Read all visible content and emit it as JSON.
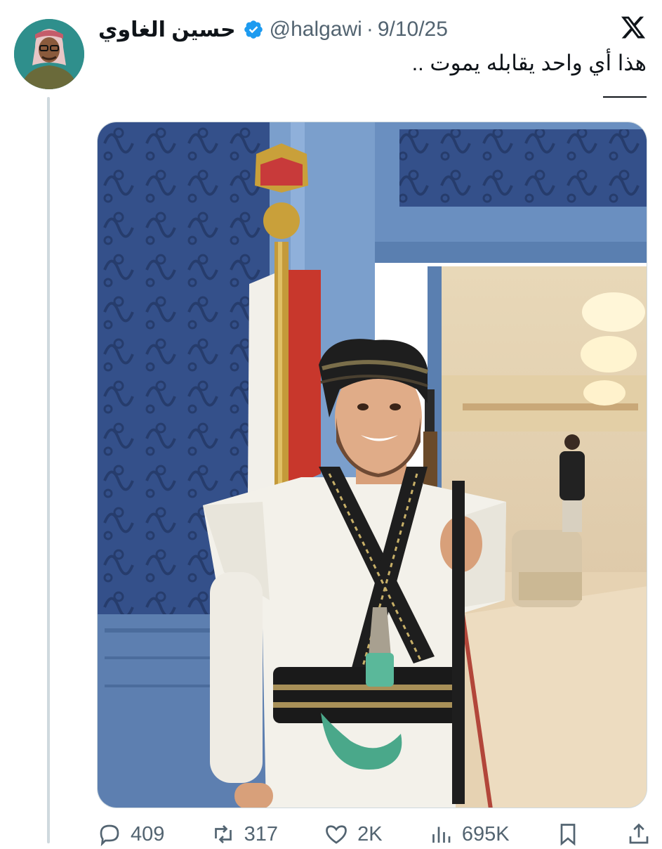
{
  "tweet": {
    "display_name": "حسين الغاوي",
    "handle": "@halgawi",
    "separator": "·",
    "date": "9/10/25",
    "text": "هذا أي واحد يقابله يموت ..",
    "dashes": "——"
  },
  "actions": {
    "replies": "409",
    "retweets": "317",
    "likes": "2K",
    "views": "695K"
  },
  "icons": {
    "reply": "speech-bubble-icon",
    "retweet": "retweet-arrows-icon",
    "like": "heart-icon",
    "views": "bar-chart-icon",
    "bookmark": "bookmark-icon",
    "share": "share-upload-icon",
    "verified": "verified-badge-icon",
    "platform": "x-logo-icon"
  },
  "colors": {
    "verified_blue": "#1d9bf0",
    "secondary_text": "#536471",
    "primary_text": "#0f1419"
  }
}
